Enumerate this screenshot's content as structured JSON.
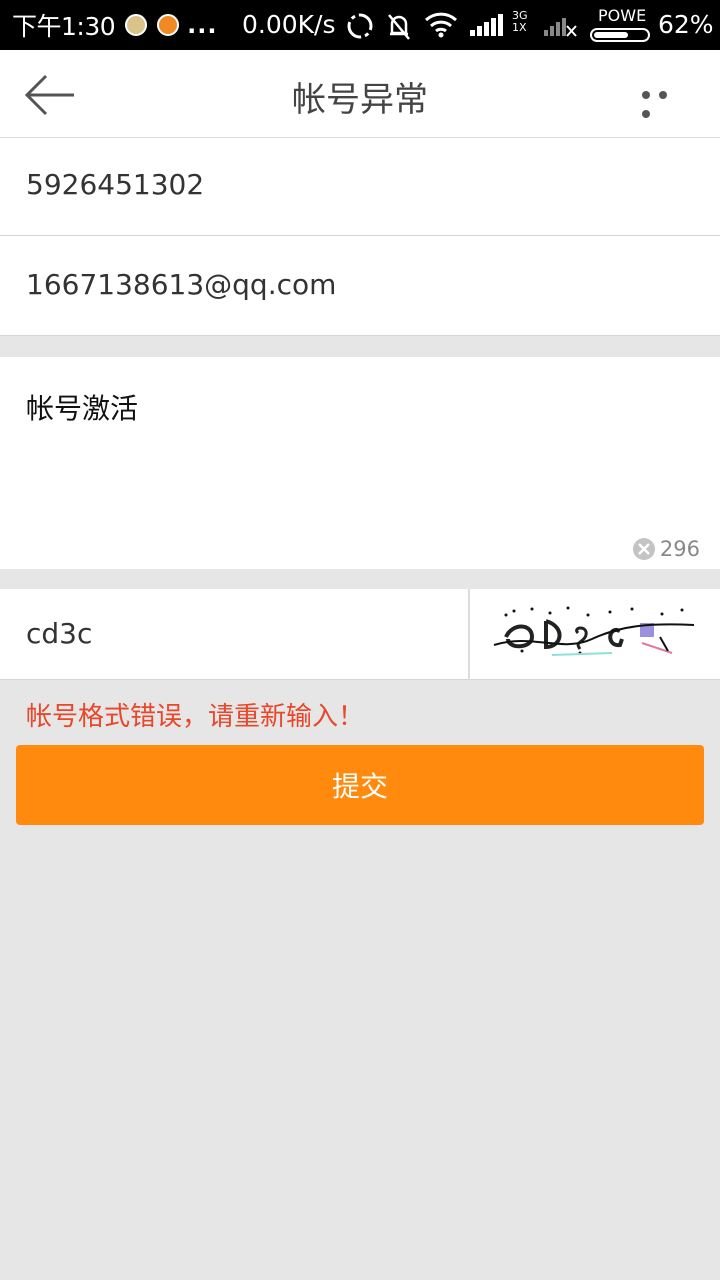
{
  "status_bar": {
    "time": "下午1:30",
    "dots": "...",
    "network_speed": "0.00K/s",
    "network_type_top": "3G",
    "network_type_bottom": "1X",
    "battery_label": "POWE",
    "battery_percent": "62%"
  },
  "nav": {
    "title": "帐号异常"
  },
  "form": {
    "qq_number": "5926451302",
    "email": "1667138613@qq.com",
    "description": "帐号激活",
    "char_remaining": "296",
    "captcha_input": "cd3c",
    "error_message": "帐号格式错误，请重新输入！",
    "submit_label": "提交"
  },
  "colors": {
    "accent": "#ff8a0d",
    "error": "#e8472a",
    "background": "#e6e6e6"
  }
}
